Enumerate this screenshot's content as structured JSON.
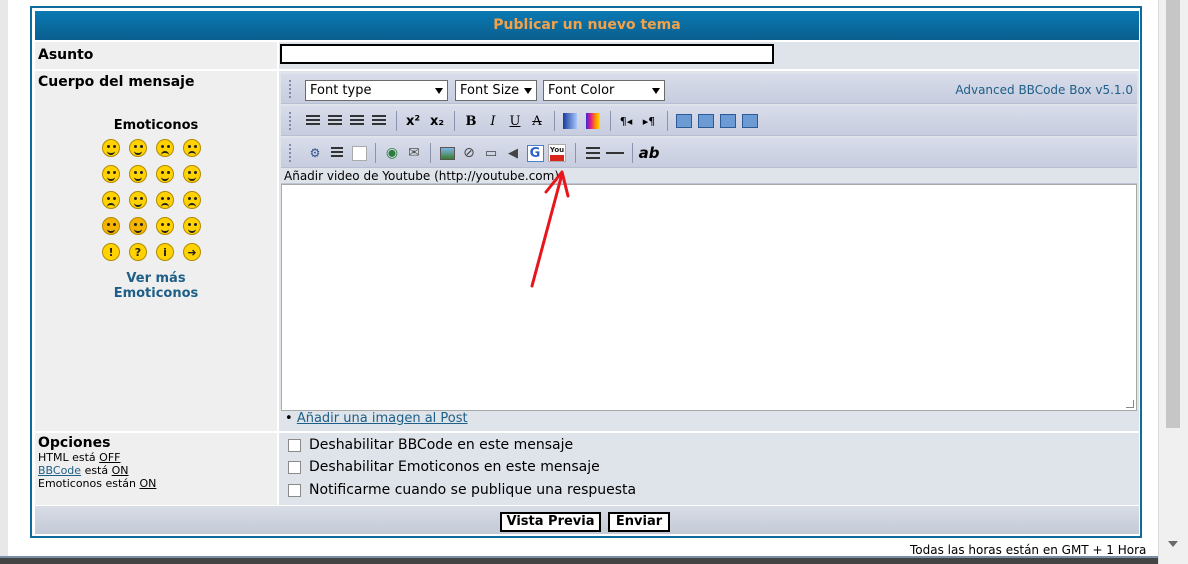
{
  "header": {
    "title": "Publicar un nuevo tema"
  },
  "form": {
    "subject_label": "Asunto",
    "subject_value": "",
    "body_label": "Cuerpo del mensaje"
  },
  "emoticons": {
    "title": "Emoticonos",
    "more_line1": "Ver más",
    "more_line2": "Emoticonos",
    "items": [
      "grin-icon",
      "smile-icon",
      "sad-icon",
      "surprised-icon",
      "eek-icon",
      "confused-icon",
      "cool-icon",
      "laugh-icon",
      "mad-icon",
      "razz-icon",
      "embarrassed-icon",
      "cry-icon",
      "evil-icon",
      "twisted-icon",
      "rolleyes-icon",
      "wink-icon",
      "exclaim-icon",
      "question-icon",
      "idea-icon",
      "arrow-icon"
    ]
  },
  "toolbar": {
    "font_type": "Font type",
    "font_size": "Font Size",
    "font_color": "Font Color",
    "version": "Advanced BBCode Box v5.1.0",
    "row2_icons": [
      "align-left-icon",
      "align-center-icon",
      "align-right-icon",
      "align-justify-icon",
      "superscript-icon",
      "subscript-icon",
      "bold-icon",
      "italic-icon",
      "underline-icon",
      "strikethrough-icon",
      "gradient-icon",
      "rainbow-icon",
      "rtl-icon",
      "ltr-icon",
      "indent-icon",
      "outdent-icon",
      "margin-icon",
      "padding-icon"
    ],
    "row3_icons": [
      "code-icon",
      "quote-icon",
      "spoiler-icon",
      "web-icon",
      "email-icon",
      "image-icon",
      "flash-icon",
      "video-icon",
      "sound-icon",
      "google-icon",
      "youtube-icon",
      "list-icon",
      "hr-icon",
      "font-icon"
    ],
    "superscript_text": "x²",
    "subscript_text": "x₂",
    "bold_text": "B",
    "italic_text": "I",
    "underline_text": "U",
    "strike_text": "A",
    "google_text": "G",
    "youtube_text": "You",
    "abbr_text": "ab"
  },
  "status_text": "Añadir video de Youtube (http://youtube.com)",
  "add_image_link": "Añadir una imagen al Post",
  "options": {
    "title": "Opciones",
    "html_label": "HTML está",
    "html_state": "OFF",
    "bbcode_label": "BBCode",
    "bbcode_mid": "está",
    "bbcode_state": "ON",
    "emo_label": "Emoticonos están",
    "emo_state": "ON",
    "checks": [
      "Deshabilitar BBCode en este mensaje",
      "Deshabilitar Emoticonos en este mensaje",
      "Notificarme cuando se publique una respuesta"
    ]
  },
  "buttons": {
    "preview": "Vista Previa",
    "submit": "Enviar"
  },
  "footer": {
    "timezone": "Todas las horas están en GMT + 1 Hora"
  },
  "colors": {
    "header_bg": "#0a6ea3",
    "header_text": "#f2a24a",
    "link": "#1d5f86",
    "annotation_arrow": "#e8161b"
  }
}
